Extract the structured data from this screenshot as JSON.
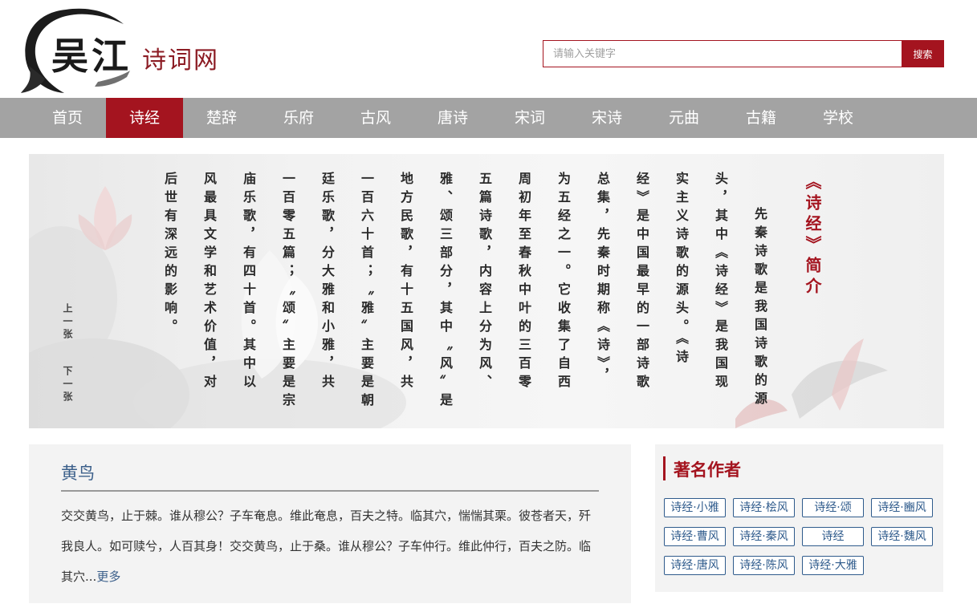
{
  "header": {
    "logo_big": "吴江",
    "logo_small": "诗词网",
    "search_placeholder": "请输入关键字",
    "search_button": "搜索"
  },
  "nav": {
    "items": [
      "首页",
      "诗经",
      "楚辞",
      "乐府",
      "古风",
      "唐诗",
      "宋词",
      "宋诗",
      "元曲",
      "古籍",
      "学校"
    ],
    "active_index": 1
  },
  "banner": {
    "title": "《诗经》简介",
    "columns": [
      "先秦诗歌是我国诗歌的源",
      "头，其中《诗经》是我国现",
      "实主义诗歌的源头。《诗",
      "经》是中国最早的一部诗歌",
      "总集，先秦时期称《诗》，",
      "为五经之一。它收集了自西",
      "周初年至春秋中叶的三百零",
      "五篇诗歌，内容上分为风、",
      "雅、颂三部分，其中〝风〞是",
      "地方民歌，有十五国风，共",
      "一百六十首；〝雅〞主要是朝",
      "廷乐歌，分大雅和小雅，共",
      "一百零五篇；〝颂〞主要是宗",
      "庙乐歌，有四十首。其中以",
      "风最具文学和艺术价值，对",
      "后世有深远的影响。"
    ],
    "prev": "上一张",
    "next": "下一张"
  },
  "poem": {
    "title": "黄鸟",
    "excerpt": "交交黄鸟，止于棘。谁从穆公？子车奄息。维此奄息，百夫之特。临其穴，惴惴其栗。彼苍者天，歼我良人。如可赎兮，人百其身！交交黄鸟，止于桑。谁从穆公？子车仲行。维此仲行，百夫之防。临其穴...",
    "more": "更多"
  },
  "authors": {
    "heading": "著名作者",
    "tags": [
      "诗经·小雅",
      "诗经·桧风",
      "诗经·颂",
      "诗经·豳风",
      "诗经·曹风",
      "诗经·秦风",
      "诗经",
      "诗经·魏风",
      "诗经·唐风",
      "诗经·陈风",
      "诗经·大雅"
    ]
  },
  "colors": {
    "accent": "#a4141f",
    "nav_bg": "#a3a3a3",
    "link": "#3b5f8a"
  }
}
